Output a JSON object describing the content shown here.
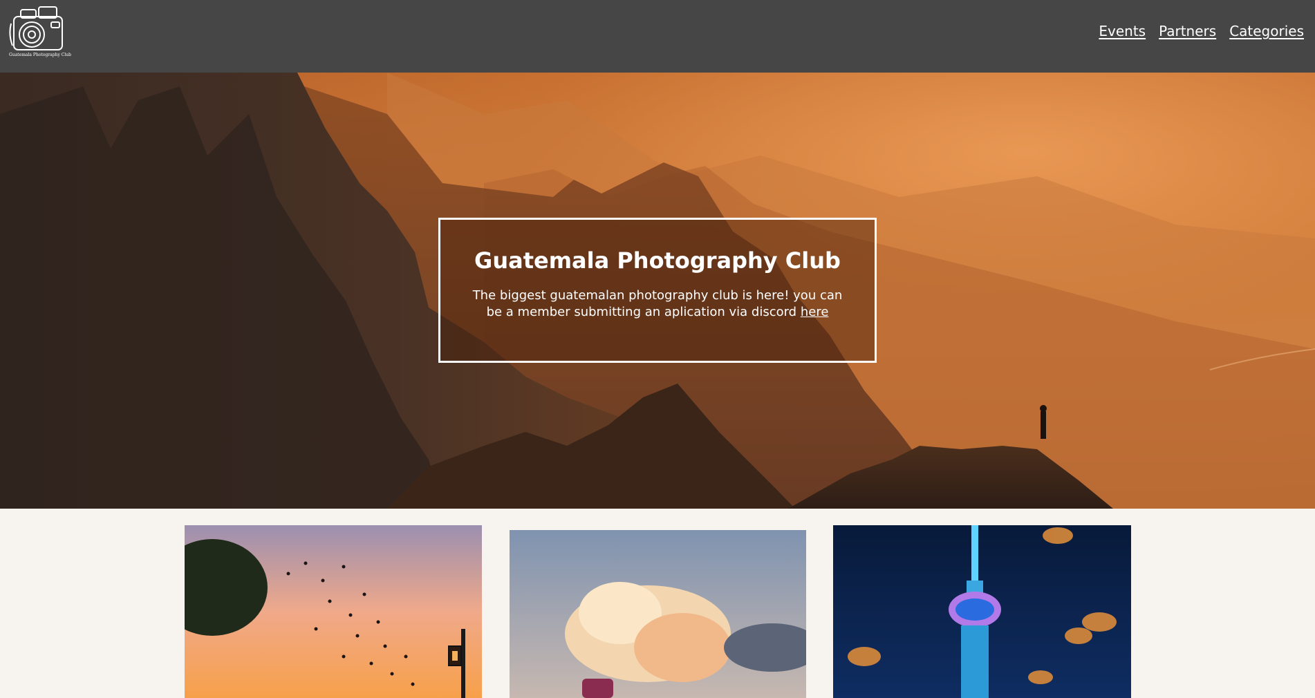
{
  "header": {
    "logo_text": "Guatemala Photography Club",
    "nav": [
      {
        "label": "Events"
      },
      {
        "label": "Partners"
      },
      {
        "label": "Categories"
      }
    ]
  },
  "hero": {
    "title": "Guatemala Photography Club",
    "text": "The biggest guatemalan photography club is here! you can be a member submitting an aplication via discord ",
    "link_label": "here"
  },
  "colors": {
    "header_bg": "#464646",
    "page_bg": "#f7f3ee",
    "hero_orange": "#d68a47"
  },
  "icons": [
    "camera-logo-icon"
  ]
}
